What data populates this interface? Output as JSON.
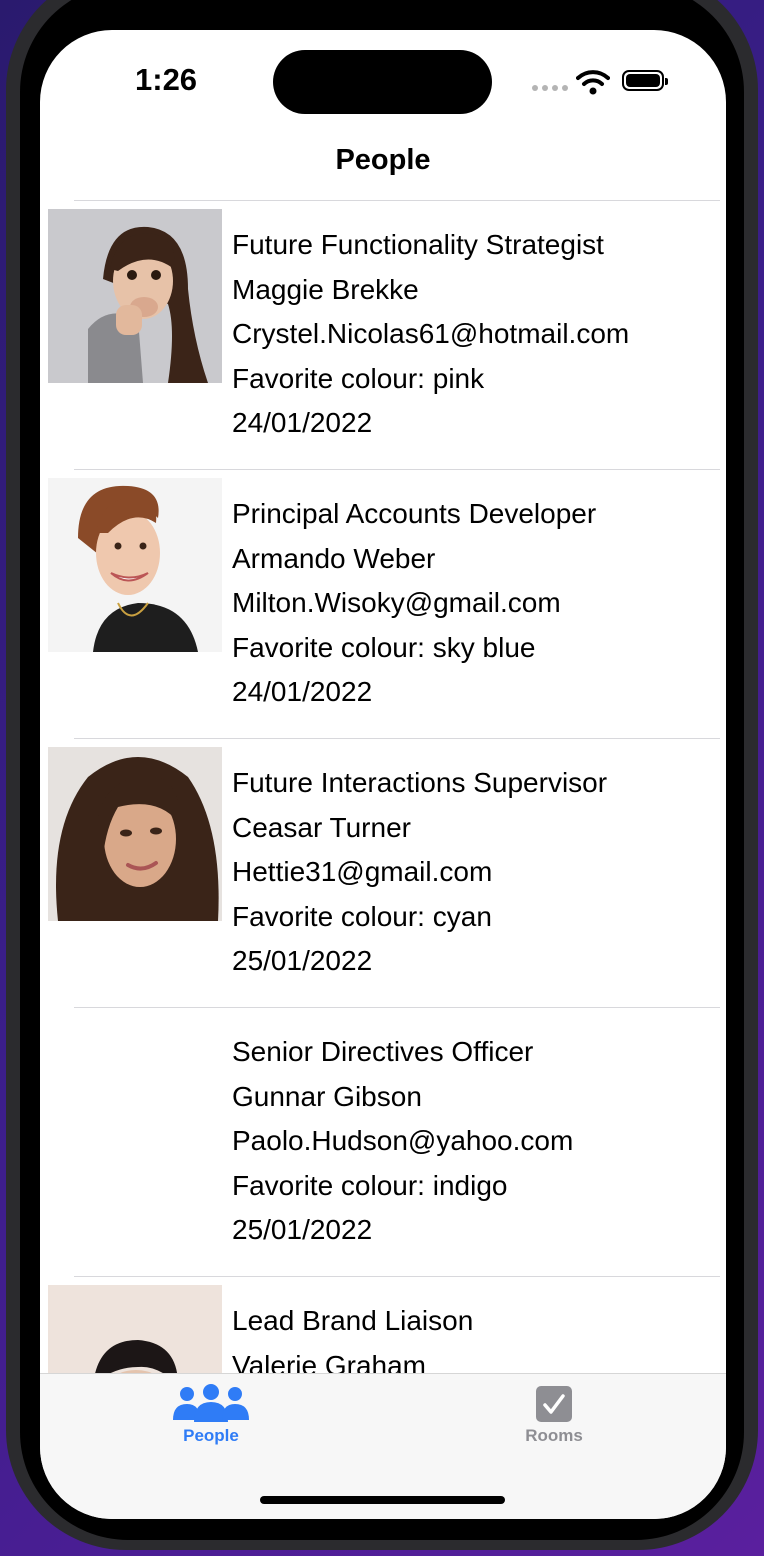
{
  "status_bar": {
    "time": "1:26"
  },
  "nav": {
    "title": "People"
  },
  "people": [
    {
      "title": "Future Functionality Strategist",
      "name": "Maggie Brekke",
      "email": "Crystel.Nicolas61@hotmail.com",
      "colour": "Favorite colour: pink",
      "date": "24/01/2022",
      "photo": "photo-woman-surprised"
    },
    {
      "title": "Principal Accounts Developer",
      "name": "Armando Weber",
      "email": "Milton.Wisoky@gmail.com",
      "colour": "Favorite colour: sky blue",
      "date": "24/01/2022",
      "photo": "photo-woman-smiling"
    },
    {
      "title": "Future Interactions Supervisor",
      "name": "Ceasar Turner",
      "email": "Hettie31@gmail.com",
      "colour": "Favorite colour: cyan",
      "date": "25/01/2022",
      "photo": "photo-woman-long-hair"
    },
    {
      "title": "Senior Directives Officer",
      "name": "Gunnar Gibson",
      "email": "Paolo.Hudson@yahoo.com",
      "colour": "Favorite colour: indigo",
      "date": "25/01/2022",
      "photo": "none"
    },
    {
      "title": "Lead Brand Liaison",
      "name": "Valerie Graham",
      "email": "",
      "colour": "",
      "date": "",
      "photo": "photo-person-partial"
    }
  ],
  "tab_bar": {
    "people_label": "People",
    "rooms_label": "Rooms",
    "active_color": "#2f7cf6",
    "inactive_color": "#8e8e93",
    "people_icon": "people-icon",
    "rooms_icon": "checkbox-icon"
  }
}
